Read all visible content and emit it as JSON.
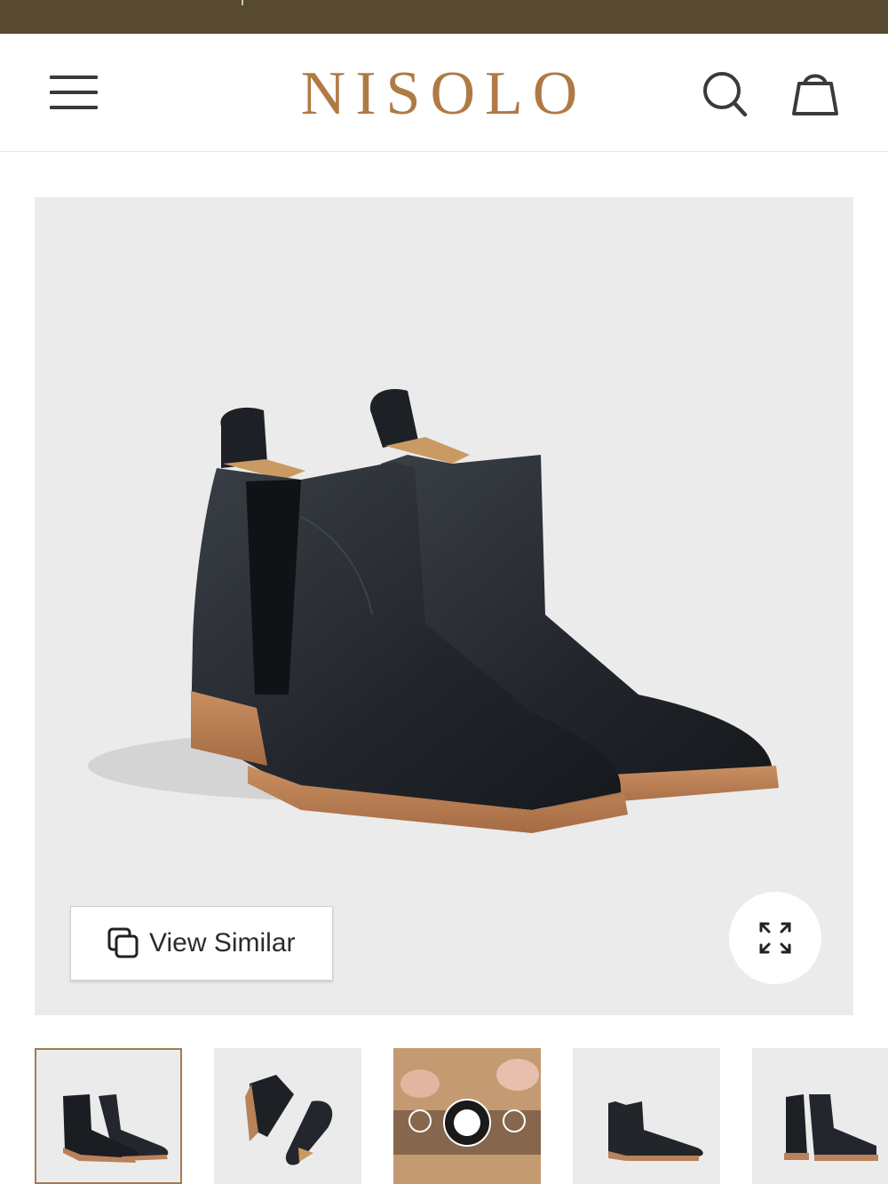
{
  "header": {
    "brand": "NISOLO"
  },
  "product_gallery": {
    "view_similar_label": "View Similar",
    "thumbnails": [
      {
        "label": "black chelsea boot pair",
        "selected": true
      },
      {
        "label": "boots from above"
      },
      {
        "label": "leather crafting"
      },
      {
        "label": "single boot side"
      },
      {
        "label": "boots back view"
      }
    ]
  },
  "colors": {
    "topbar": "#574a2e",
    "brand": "#b07a44",
    "selected_border": "#a47c50"
  }
}
